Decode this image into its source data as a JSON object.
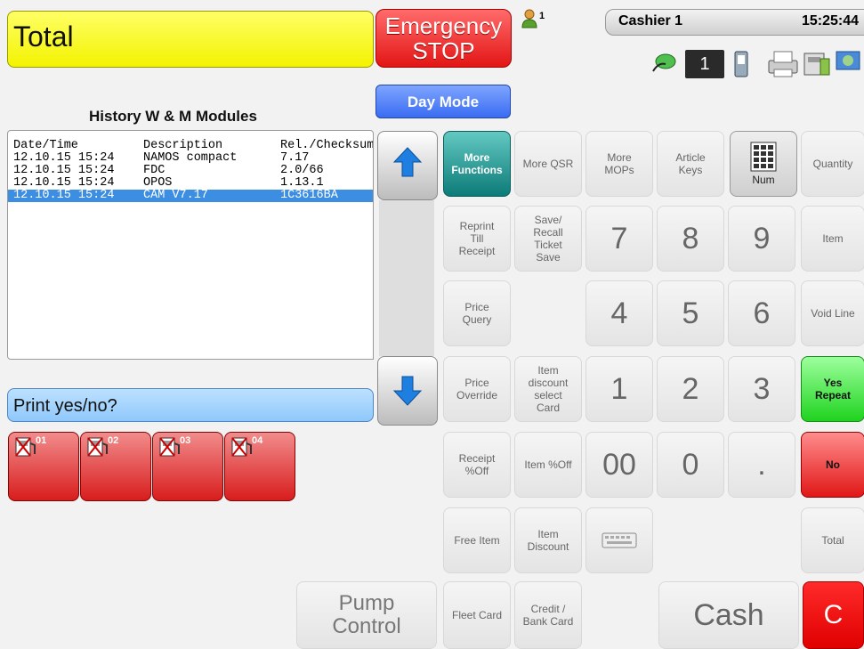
{
  "total_label": "Total",
  "emergency": {
    "line1": "Emergency",
    "line2": "STOP"
  },
  "user_count": "1",
  "cashier": {
    "name": "Cashier 1",
    "time": "15:25:44"
  },
  "terminal_number": "1",
  "day_mode": "Day Mode",
  "history": {
    "title": "History W & M Modules",
    "headers": [
      "Date/Time",
      "Description",
      "Rel./Checksum"
    ],
    "rows": [
      [
        "12.10.15 15:24",
        "NAMOS compact",
        "7.17"
      ],
      [
        "12.10.15 15:24",
        "FDC",
        "2.0/66"
      ],
      [
        "12.10.15 15:24",
        "OPOS",
        "1.13.1"
      ],
      [
        "12.10.15 15:24",
        "CAM V7.17",
        "1C3616BA"
      ]
    ],
    "selected_row": 3
  },
  "prompt": "Print yes/no?",
  "pumps": [
    "01",
    "02",
    "03",
    "04"
  ],
  "keys": {
    "more_functions": [
      "More",
      "Functions"
    ],
    "more_qsr": "More QSR",
    "more_mops": [
      "More",
      "MOPs"
    ],
    "article_keys": [
      "Article",
      "Keys"
    ],
    "num_label": "Num",
    "quantity": "Quantity",
    "reprint": [
      "Reprint",
      "Till",
      "Receipt"
    ],
    "save_recall": [
      "Save/",
      "Recall",
      "Ticket",
      "Save"
    ],
    "k7": "7",
    "k8": "8",
    "k9": "9",
    "item": "Item",
    "price_query": [
      "Price",
      "Query"
    ],
    "k4": "4",
    "k5": "5",
    "k6": "6",
    "void_line": "Void Line",
    "price_override": [
      "Price",
      "Override"
    ],
    "item_discount_select": [
      "Item",
      "discount",
      "select",
      "Card"
    ],
    "k1": "1",
    "k2": "2",
    "k3": "3",
    "yes_repeat": [
      "Yes",
      "Repeat"
    ],
    "receipt_off": [
      "Receipt",
      "%Off"
    ],
    "item_off": "Item %Off",
    "k00": "00",
    "k0": "0",
    "kdot": ".",
    "no": "No",
    "free_item": "Free Item",
    "item_discount": [
      "Item",
      "Discount"
    ],
    "total": "Total",
    "pump_control": [
      "Pump",
      "Control"
    ],
    "fleet_card": "Fleet Card",
    "credit_bank": [
      "Credit /",
      "Bank Card"
    ],
    "cash": "Cash",
    "clear": "C"
  }
}
